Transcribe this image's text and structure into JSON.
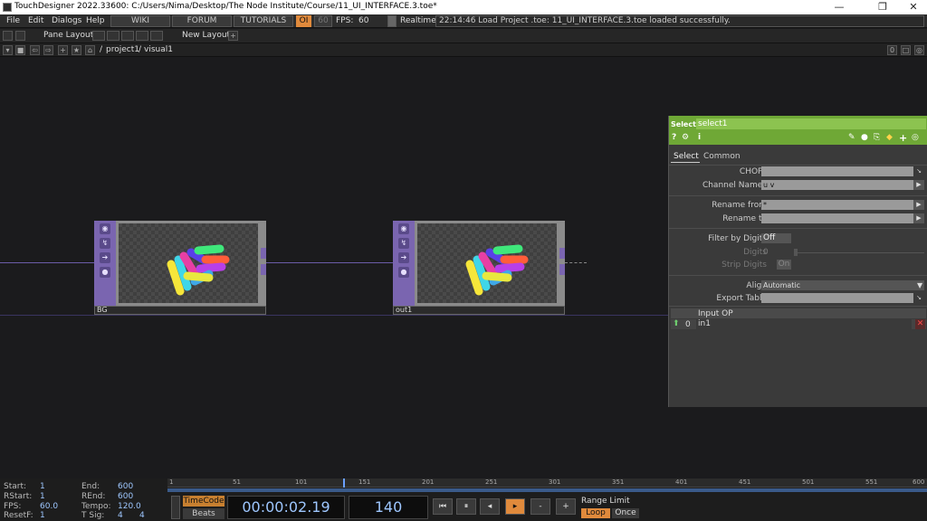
{
  "titlebar": {
    "title": "TouchDesigner 2022.33600: C:/Users/Nima/Desktop/The Node Institute/Course/11_UI_INTERFACE.3.toe*",
    "minimize": "—",
    "maximize": "❐",
    "close": "✕"
  },
  "menu": {
    "items": [
      "File",
      "Edit",
      "Dialogs",
      "Help"
    ],
    "wiki": "WIKI",
    "forum": "FORUM",
    "tutorials": "TUTORIALS",
    "oi": "OI",
    "fps_cap": "60",
    "fps_label": "FPS:",
    "fps_value": "60",
    "realtime": "Realtime",
    "status": "22:14:46 Load Project .toe: 11_UI_INTERFACE.3.toe loaded successfully."
  },
  "panebar": {
    "pane_layout": "Pane Layout",
    "new_layout": "New Layout",
    "plus": "+"
  },
  "path": {
    "root": "/",
    "project": "project1",
    "sep": "/",
    "current": "visual1",
    "count": "0"
  },
  "nodes": [
    {
      "name": "BG"
    },
    {
      "name": "out1"
    }
  ],
  "params": {
    "type": "Select",
    "name": "select1",
    "tabs": [
      "Select",
      "Common"
    ],
    "chops_label": "CHOPs",
    "chops_value": "",
    "channel_names_label": "Channel Names",
    "channel_names_value": "u v",
    "rename_from_label": "Rename from",
    "rename_from_value": "*",
    "rename_to_label": "Rename to",
    "rename_to_value": "",
    "filter_digits_label": "Filter by Digits",
    "filter_digits_value": "Off",
    "digits_label": "Digits",
    "digits_value": "0",
    "strip_digits_label": "Strip Digits",
    "strip_digits_value": "On",
    "align_label": "Align",
    "align_value": "Automatic",
    "export_table_label": "Export Table",
    "export_table_value": "",
    "input_op_header": "Input OP",
    "input_index": "0",
    "input_value": "in1"
  },
  "bottom": {
    "start_label": "Start:",
    "start": "1",
    "rstart_label": "RStart:",
    "rstart": "1",
    "fps_label": "FPS:",
    "fps": "60.0",
    "resetf_label": "ResetF:",
    "resetf": "1",
    "end_label": "End:",
    "end": "600",
    "rend_label": "REnd:",
    "rend": "600",
    "tempo_label": "Tempo:",
    "tempo": "120.0",
    "tsig_label": "T Sig:",
    "tsig_a": "4",
    "tsig_b": "4",
    "timecode_btn": "TimeCode",
    "beats_btn": "Beats",
    "timecode": "00:00:02.19",
    "frame": "140",
    "range_limit": "Range Limit",
    "loop": "Loop",
    "once": "Once",
    "ruler": [
      "1",
      "51",
      "101",
      "151",
      "201",
      "251",
      "301",
      "351",
      "401",
      "451",
      "501",
      "551",
      "600"
    ]
  },
  "colors": {
    "accent": "#6fa836",
    "node_purple": "#7a65b0",
    "play_orange": "#e08a3c"
  }
}
